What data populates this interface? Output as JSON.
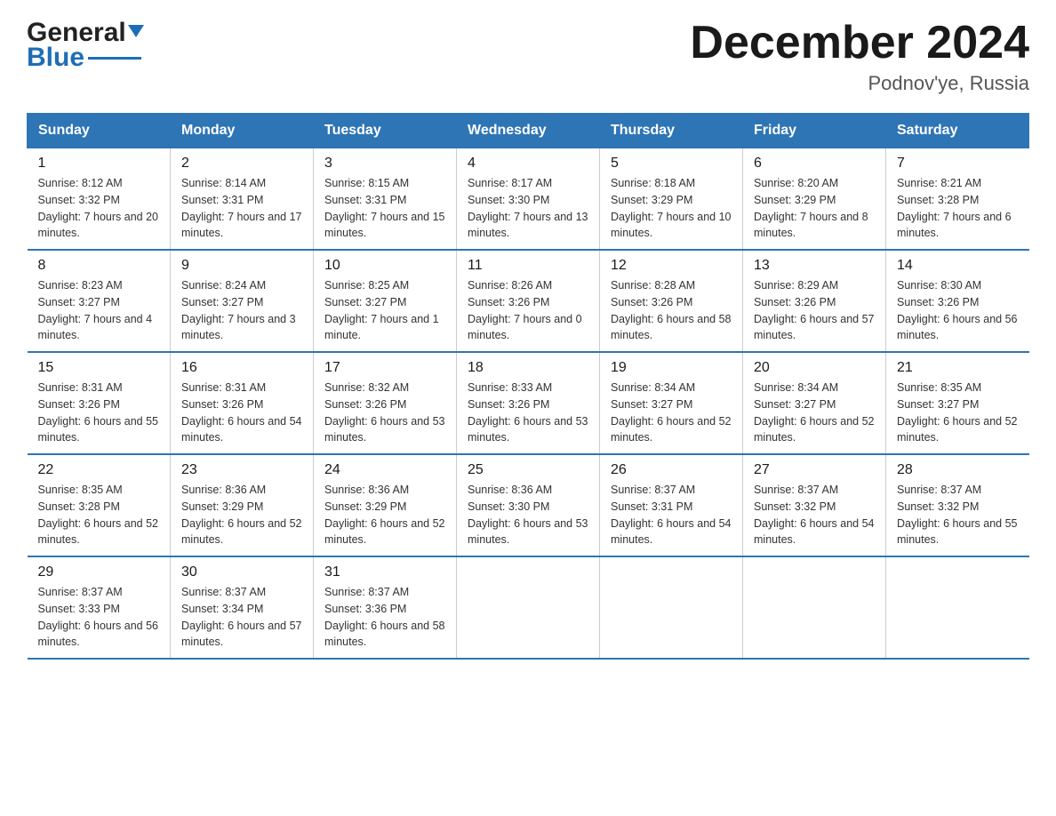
{
  "header": {
    "logo_general": "General",
    "logo_blue": "Blue",
    "title": "December 2024",
    "subtitle": "Podnov'ye, Russia"
  },
  "days_of_week": [
    "Sunday",
    "Monday",
    "Tuesday",
    "Wednesday",
    "Thursday",
    "Friday",
    "Saturday"
  ],
  "weeks": [
    [
      {
        "day": "1",
        "sunrise": "8:12 AM",
        "sunset": "3:32 PM",
        "daylight": "7 hours and 20 minutes."
      },
      {
        "day": "2",
        "sunrise": "8:14 AM",
        "sunset": "3:31 PM",
        "daylight": "7 hours and 17 minutes."
      },
      {
        "day": "3",
        "sunrise": "8:15 AM",
        "sunset": "3:31 PM",
        "daylight": "7 hours and 15 minutes."
      },
      {
        "day": "4",
        "sunrise": "8:17 AM",
        "sunset": "3:30 PM",
        "daylight": "7 hours and 13 minutes."
      },
      {
        "day": "5",
        "sunrise": "8:18 AM",
        "sunset": "3:29 PM",
        "daylight": "7 hours and 10 minutes."
      },
      {
        "day": "6",
        "sunrise": "8:20 AM",
        "sunset": "3:29 PM",
        "daylight": "7 hours and 8 minutes."
      },
      {
        "day": "7",
        "sunrise": "8:21 AM",
        "sunset": "3:28 PM",
        "daylight": "7 hours and 6 minutes."
      }
    ],
    [
      {
        "day": "8",
        "sunrise": "8:23 AM",
        "sunset": "3:27 PM",
        "daylight": "7 hours and 4 minutes."
      },
      {
        "day": "9",
        "sunrise": "8:24 AM",
        "sunset": "3:27 PM",
        "daylight": "7 hours and 3 minutes."
      },
      {
        "day": "10",
        "sunrise": "8:25 AM",
        "sunset": "3:27 PM",
        "daylight": "7 hours and 1 minute."
      },
      {
        "day": "11",
        "sunrise": "8:26 AM",
        "sunset": "3:26 PM",
        "daylight": "7 hours and 0 minutes."
      },
      {
        "day": "12",
        "sunrise": "8:28 AM",
        "sunset": "3:26 PM",
        "daylight": "6 hours and 58 minutes."
      },
      {
        "day": "13",
        "sunrise": "8:29 AM",
        "sunset": "3:26 PM",
        "daylight": "6 hours and 57 minutes."
      },
      {
        "day": "14",
        "sunrise": "8:30 AM",
        "sunset": "3:26 PM",
        "daylight": "6 hours and 56 minutes."
      }
    ],
    [
      {
        "day": "15",
        "sunrise": "8:31 AM",
        "sunset": "3:26 PM",
        "daylight": "6 hours and 55 minutes."
      },
      {
        "day": "16",
        "sunrise": "8:31 AM",
        "sunset": "3:26 PM",
        "daylight": "6 hours and 54 minutes."
      },
      {
        "day": "17",
        "sunrise": "8:32 AM",
        "sunset": "3:26 PM",
        "daylight": "6 hours and 53 minutes."
      },
      {
        "day": "18",
        "sunrise": "8:33 AM",
        "sunset": "3:26 PM",
        "daylight": "6 hours and 53 minutes."
      },
      {
        "day": "19",
        "sunrise": "8:34 AM",
        "sunset": "3:27 PM",
        "daylight": "6 hours and 52 minutes."
      },
      {
        "day": "20",
        "sunrise": "8:34 AM",
        "sunset": "3:27 PM",
        "daylight": "6 hours and 52 minutes."
      },
      {
        "day": "21",
        "sunrise": "8:35 AM",
        "sunset": "3:27 PM",
        "daylight": "6 hours and 52 minutes."
      }
    ],
    [
      {
        "day": "22",
        "sunrise": "8:35 AM",
        "sunset": "3:28 PM",
        "daylight": "6 hours and 52 minutes."
      },
      {
        "day": "23",
        "sunrise": "8:36 AM",
        "sunset": "3:29 PM",
        "daylight": "6 hours and 52 minutes."
      },
      {
        "day": "24",
        "sunrise": "8:36 AM",
        "sunset": "3:29 PM",
        "daylight": "6 hours and 52 minutes."
      },
      {
        "day": "25",
        "sunrise": "8:36 AM",
        "sunset": "3:30 PM",
        "daylight": "6 hours and 53 minutes."
      },
      {
        "day": "26",
        "sunrise": "8:37 AM",
        "sunset": "3:31 PM",
        "daylight": "6 hours and 54 minutes."
      },
      {
        "day": "27",
        "sunrise": "8:37 AM",
        "sunset": "3:32 PM",
        "daylight": "6 hours and 54 minutes."
      },
      {
        "day": "28",
        "sunrise": "8:37 AM",
        "sunset": "3:32 PM",
        "daylight": "6 hours and 55 minutes."
      }
    ],
    [
      {
        "day": "29",
        "sunrise": "8:37 AM",
        "sunset": "3:33 PM",
        "daylight": "6 hours and 56 minutes."
      },
      {
        "day": "30",
        "sunrise": "8:37 AM",
        "sunset": "3:34 PM",
        "daylight": "6 hours and 57 minutes."
      },
      {
        "day": "31",
        "sunrise": "8:37 AM",
        "sunset": "3:36 PM",
        "daylight": "6 hours and 58 minutes."
      },
      null,
      null,
      null,
      null
    ]
  ],
  "labels": {
    "sunrise": "Sunrise:",
    "sunset": "Sunset:",
    "daylight": "Daylight:"
  }
}
